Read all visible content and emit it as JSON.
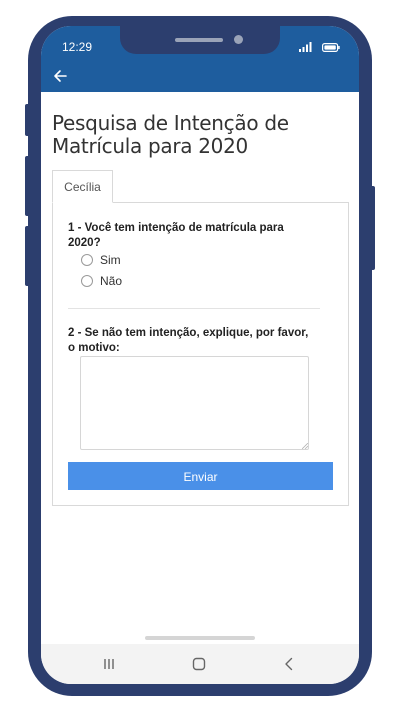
{
  "status_bar": {
    "time": "12:29"
  },
  "app_bar": {
    "back_icon": "arrow-left-icon",
    "background_color": "#1e5d9e"
  },
  "page": {
    "title": "Pesquisa de Intenção de Matrícula para 2020"
  },
  "tabs": [
    {
      "label": "Cecília",
      "active": true
    }
  ],
  "form": {
    "question1": {
      "text": "1 - Você tem intenção de matrícula para 2020?",
      "options": [
        {
          "label": "Sim",
          "selected": false
        },
        {
          "label": "Não",
          "selected": false
        }
      ]
    },
    "question2": {
      "text": "2 - Se não tem intenção, explique, por favor, o motivo:",
      "value": "",
      "placeholder": ""
    },
    "submit_label": "Enviar",
    "submit_color": "#4a90e8"
  },
  "nav_bar": {
    "icons": [
      "recents-icon",
      "home-icon",
      "back-icon"
    ]
  },
  "colors": {
    "phone_frame": "#2c3e6e"
  }
}
